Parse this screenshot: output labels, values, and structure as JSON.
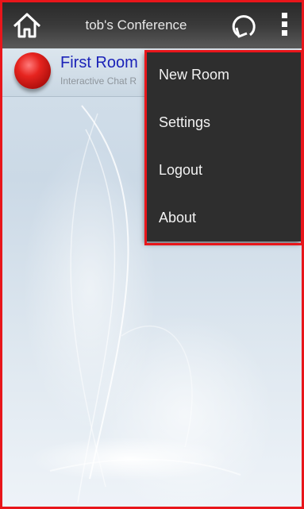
{
  "actionbar": {
    "title": "tob's Conference",
    "home_icon": "home-icon",
    "refresh_icon": "refresh-icon",
    "overflow_icon": "overflow-menu-icon"
  },
  "rooms": [
    {
      "name": "First Room",
      "subtitle": "Interactive Chat R"
    }
  ],
  "menu": {
    "items": [
      {
        "label": "New Room"
      },
      {
        "label": "Settings"
      },
      {
        "label": "Logout"
      },
      {
        "label": "About"
      }
    ]
  },
  "colors": {
    "highlight_border": "#e8161b",
    "room_name": "#1a22b8",
    "menu_bg": "#2e2e2e"
  }
}
